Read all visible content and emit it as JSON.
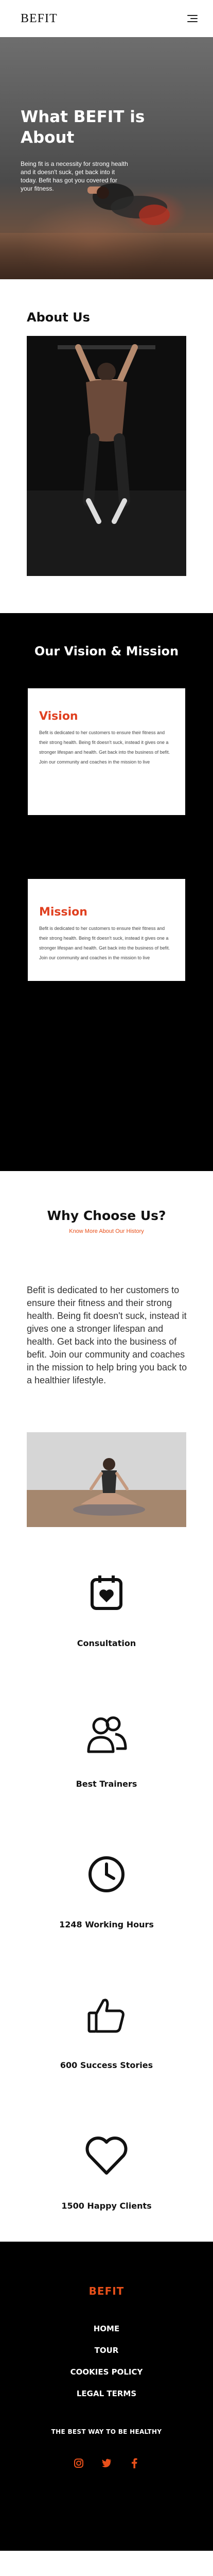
{
  "header": {
    "logo": "BEFIT",
    "menu_icon": "hamburger-menu-icon"
  },
  "hero": {
    "title": "What BEFIT is About",
    "text": "Being fit is a necessity for strong health and it doesn't suck, get back into it today. Befit has got you covered for your fitness."
  },
  "about": {
    "title": "About Us"
  },
  "vision_mission": {
    "title": "Our Vision & Mission",
    "vision": {
      "title": "Vision",
      "text": "Befit is dedicated to her customers to ensure their fitness and their strong health. Being fit doesn't suck, instead it gives one a stronger lifespan and health. Get back into the business of befit. Join our community and coaches in the mission to live"
    },
    "mission": {
      "title": "Mission",
      "text": "Befit is dedicated to her customers to ensure their fitness and their strong health. Being fit doesn't suck, instead it gives one a stronger lifespan and health. Get back into the business of befit. Join our community and coaches in the mission to live"
    }
  },
  "why": {
    "title": "Why Choose Us?",
    "link": "Know More About Our History",
    "text": "Befit is dedicated to her customers to ensure their fitness and their strong health. Being fit doesn't suck, instead it gives one a stronger lifespan and health. Get back into the business of befit. Join our community and coaches in the mission to help bring you back to a healthier lifestyle."
  },
  "features": [
    {
      "icon": "calendar-heart-icon",
      "label": "Consultation"
    },
    {
      "icon": "users-icon",
      "label": "Best Trainers"
    },
    {
      "icon": "clock-icon",
      "label": "1248 Working Hours"
    },
    {
      "icon": "thumbs-up-icon",
      "label": "600 Success Stories"
    },
    {
      "icon": "heart-icon",
      "label": "1500 Happy Clients"
    }
  ],
  "footer": {
    "logo": "BEFIT",
    "nav": [
      "HOME",
      "TOUR",
      "COOKIES POLICY",
      "LEGAL TERMS"
    ],
    "tagline": "THE BEST WAY TO BE HEALTHY",
    "social": [
      "instagram-icon",
      "twitter-icon",
      "facebook-icon"
    ],
    "accent_color": "#e8501a"
  }
}
